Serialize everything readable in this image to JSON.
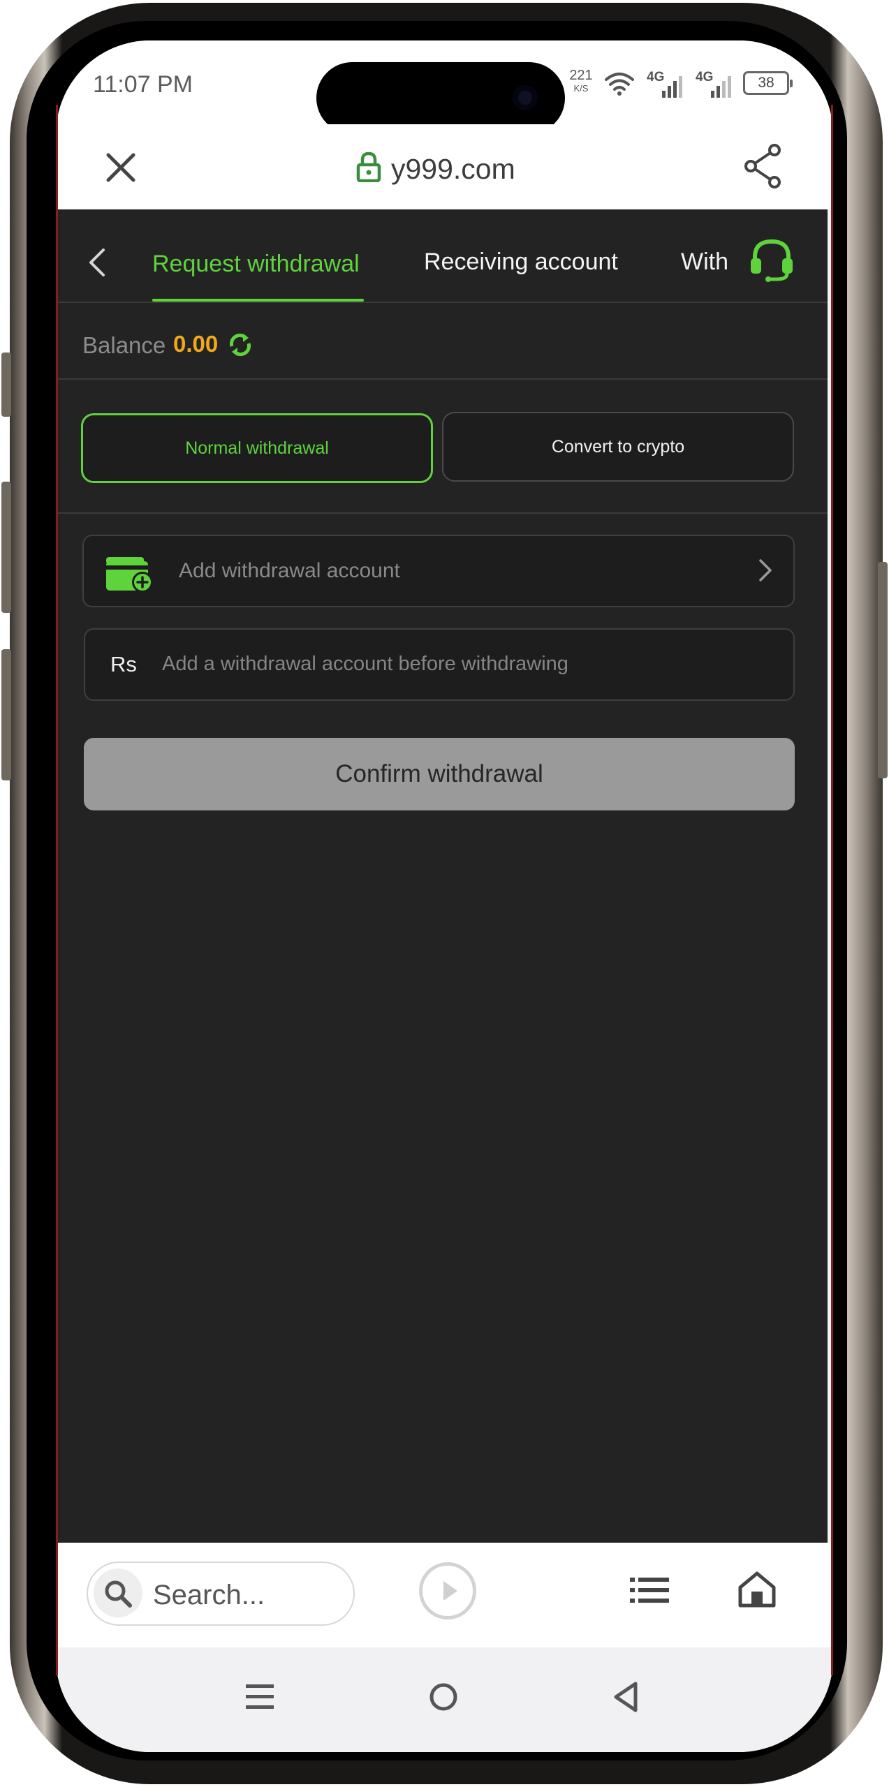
{
  "status_bar": {
    "time": "11:07 PM",
    "net_speed_value": "221",
    "net_speed_unit": "K/S",
    "signal1": "4G",
    "signal2": "4G",
    "battery": "38",
    "icons": [
      "wifi-icon",
      "signal-bars-icon",
      "signal-bars-icon",
      "battery-icon"
    ]
  },
  "browser": {
    "url": "y999.com",
    "close_icon": "close-icon",
    "lock_icon": "lock-icon",
    "share_icon": "share-icon"
  },
  "header": {
    "back_icon": "back-chevron-icon",
    "tabs": [
      {
        "label": "Request withdrawal",
        "active": true
      },
      {
        "label": "Receiving account",
        "active": false
      },
      {
        "label": "With",
        "active": false
      }
    ],
    "support_icon": "headset-icon"
  },
  "balance": {
    "label": "Balance",
    "value": "0.00",
    "refresh_icon": "refresh-icon"
  },
  "segments": {
    "normal": "Normal withdrawal",
    "crypto": "Convert to crypto",
    "selected": "normal"
  },
  "account_row": {
    "label": "Add withdrawal account",
    "icon": "wallet-add-icon"
  },
  "amount_field": {
    "currency": "Rs",
    "placeholder": "Add a withdrawal account before withdrawing"
  },
  "confirm": {
    "label": "Confirm withdrawal"
  },
  "browser_toolbar": {
    "search_placeholder": "Search...",
    "icons": [
      "search-icon",
      "play-icon",
      "list-icon",
      "home-icon"
    ]
  },
  "system_nav": {
    "icons": [
      "recents-icon",
      "home-circle-icon",
      "back-triangle-icon"
    ]
  },
  "colors": {
    "accent_green": "#5fd33c",
    "balance_orange": "#f2a81d",
    "app_background": "#232323"
  }
}
